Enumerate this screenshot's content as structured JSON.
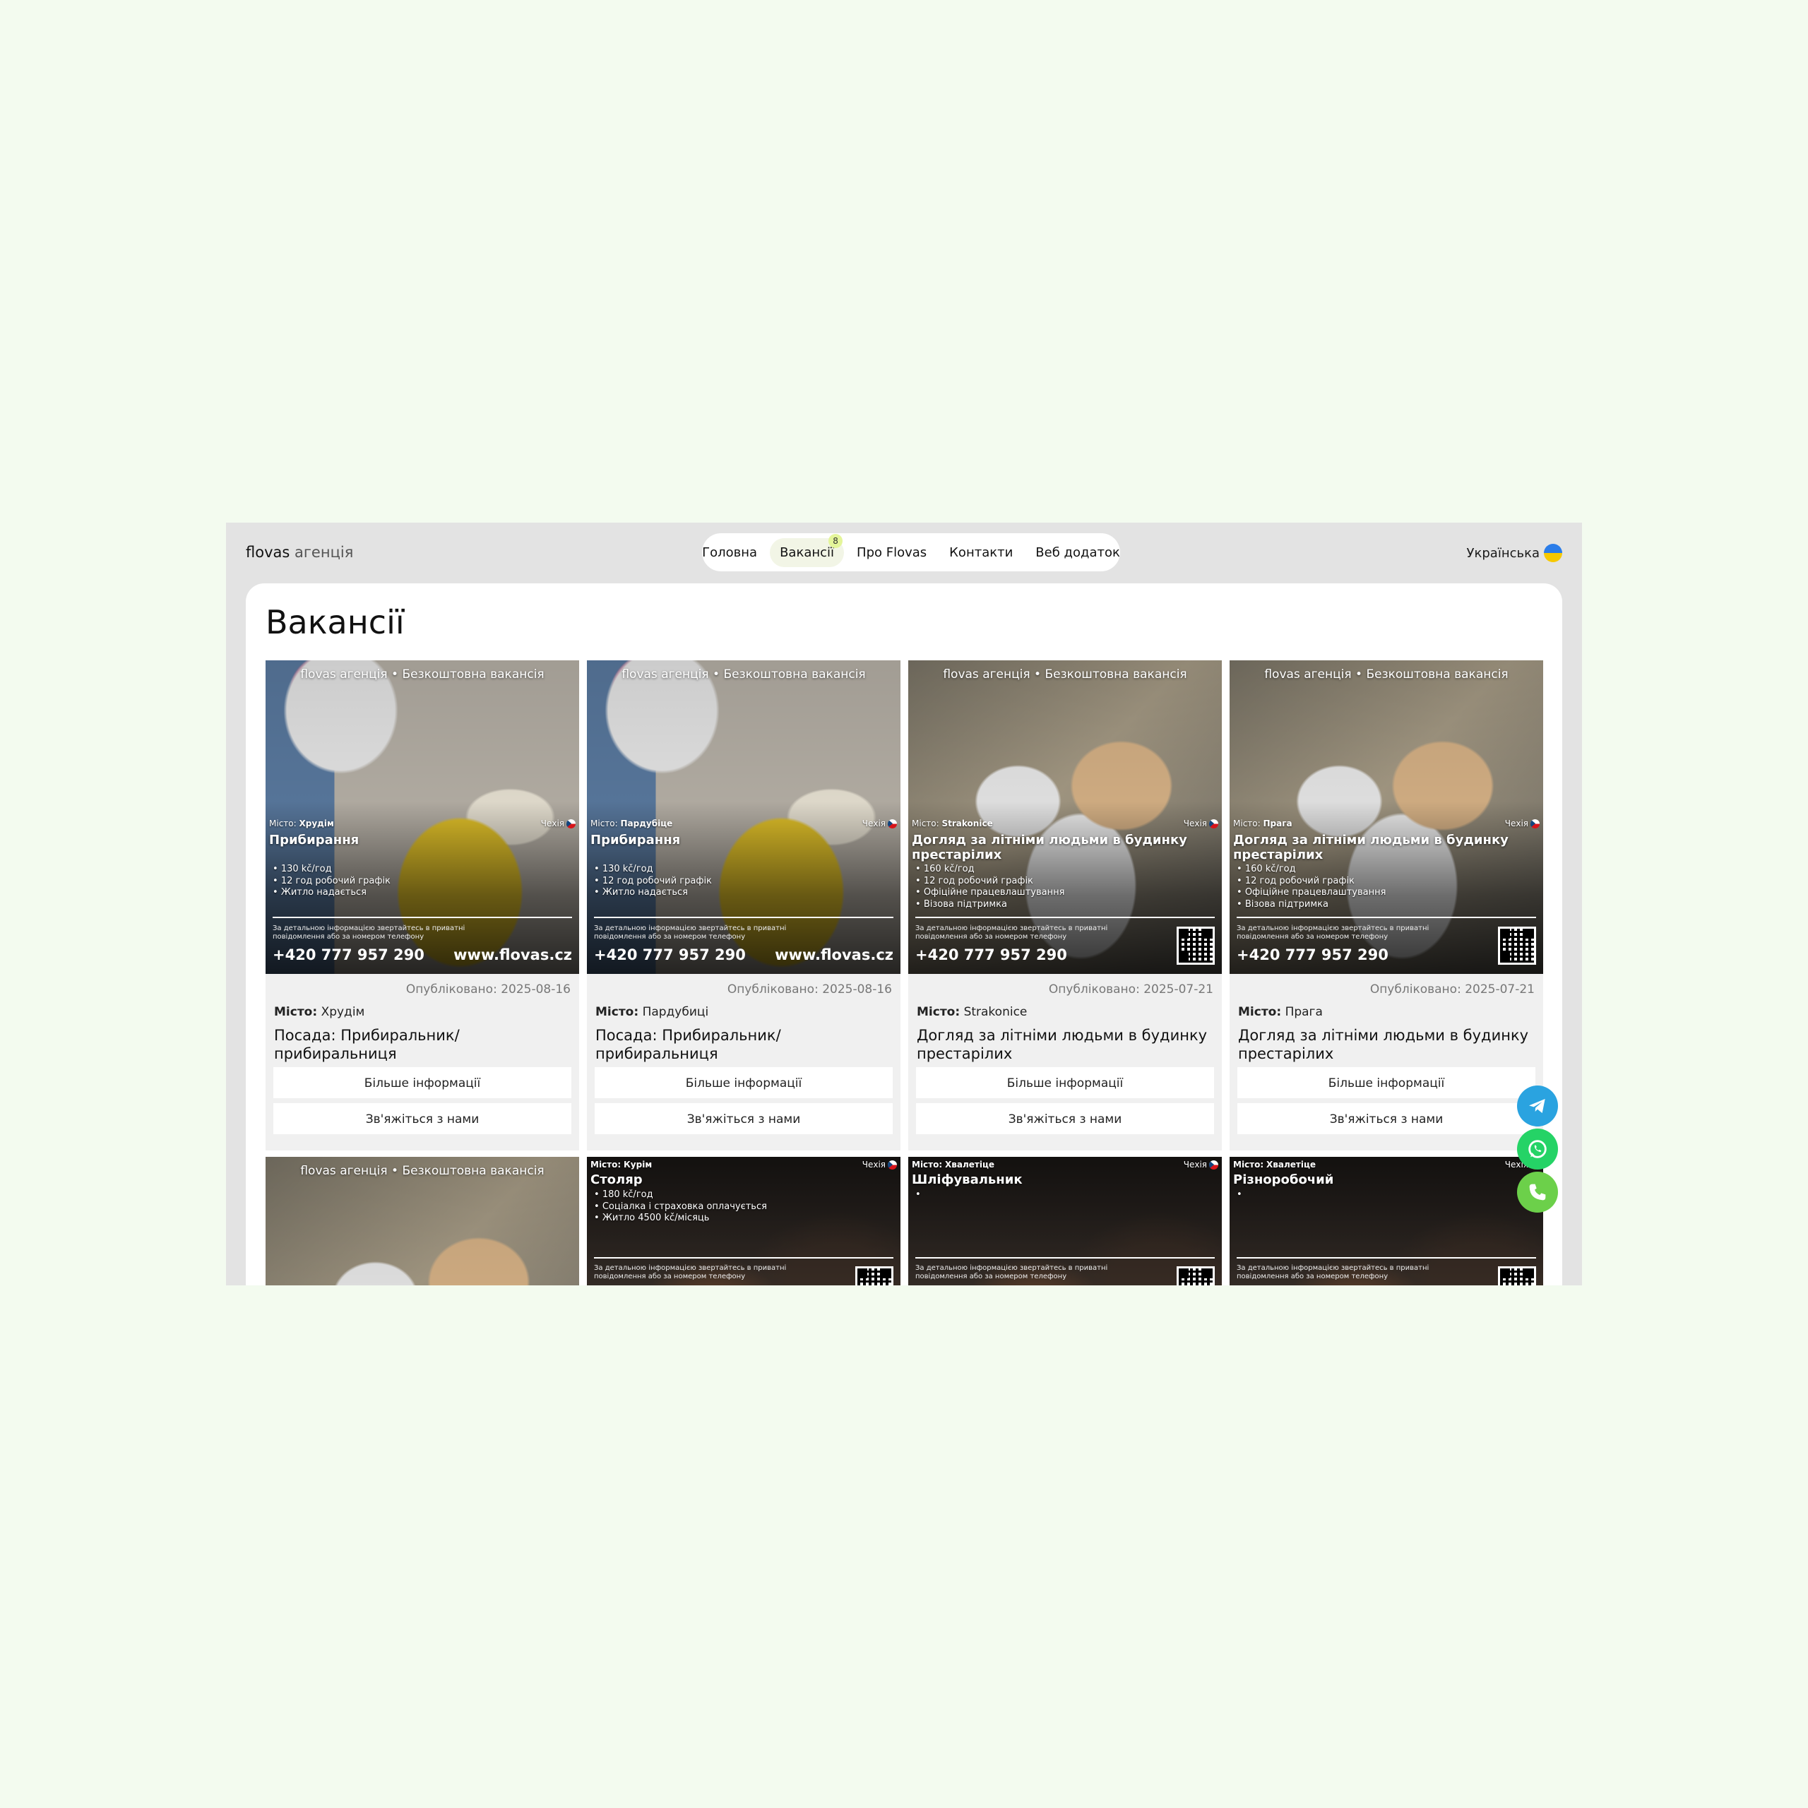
{
  "header": {
    "logo_brand": "flovas",
    "logo_sub": "агенція",
    "nav": [
      {
        "label": "Головна"
      },
      {
        "label": "Вакансії",
        "badge": "8"
      },
      {
        "label": "Про Flovas"
      },
      {
        "label": "Контакти"
      },
      {
        "label": "Веб додаток"
      }
    ],
    "language": "Українська"
  },
  "page_title": "Вакансії",
  "labels": {
    "city_label": "Місто:",
    "more_info": "Більше інформації",
    "contact_us": "Зв'яжіться з нами"
  },
  "poster": {
    "header": "flovas агенція • Безкоштовна вакансія",
    "country": "Чехія",
    "note": "За детальною інформацією звертайтесь в приватні повідомлення або за номером телефону",
    "phone": "+420 777 957 290",
    "site": "www.flovas.cz"
  },
  "cards": [
    {
      "poster_city": "Хрудім",
      "poster_title": "Прибирання",
      "bullets": [
        "130 kč/год",
        "12 год робочий графік",
        "Житло надається"
      ],
      "date": "Опубліковано: 2025-08-16",
      "city": "Хрудім",
      "position": "Посада: Прибиральник/ прибиральниця",
      "colors": {
        "accent_bucket": "#e6c52a"
      }
    },
    {
      "poster_city": "Пардубіце",
      "poster_title": "Прибирання",
      "bullets": [
        "130 kč/год",
        "12 год робочий графік",
        "Житло надається"
      ],
      "date": "Опубліковано: 2025-08-16",
      "city": "Пардубиці",
      "position": "Посада: Прибиральник/ прибиральниця"
    },
    {
      "poster_city": "Strakonice",
      "poster_title": "Догляд за літніми людьми в будинку престарілих",
      "bullets": [
        "160 kč/год",
        "12 год робочий графік",
        "Офіційне працевлаштування",
        "Візова підтримка"
      ],
      "date": "Опубліковано: 2025-07-21",
      "city": "Strakonice",
      "position": "Догляд за літніми людьми в будинку престарілих"
    },
    {
      "poster_city": "Прага",
      "poster_title": "Догляд за літніми людьми в будинку престарілих",
      "bullets": [
        "160 kč/год",
        "12 год робочий графік",
        "Офіційне працевлаштування",
        "Візова підтримка"
      ],
      "date": "Опубліковано: 2025-07-21",
      "city": "Прага",
      "position": "Догляд за літніми людьми в будинку престарілих"
    }
  ],
  "cards_row2": [
    {
      "poster_city": "",
      "poster_title": "",
      "bullets": []
    },
    {
      "poster_city": "Курім",
      "poster_title": "Столяр",
      "bullets": [
        "180 kč/год",
        "Соціалка і страховка оплачується",
        "Житло 4500 kč/місяць"
      ]
    },
    {
      "poster_city": "Хвалетіце",
      "poster_title": "Шліфувальник",
      "bullets": [
        ""
      ]
    },
    {
      "poster_city": "Хвалетіце",
      "poster_title": "Різноробочий",
      "bullets": [
        ""
      ]
    }
  ],
  "floating": {
    "colors": {
      "telegram": "#2aa3e0",
      "whatsapp": "#25d366",
      "phone": "#6cd04a"
    }
  }
}
